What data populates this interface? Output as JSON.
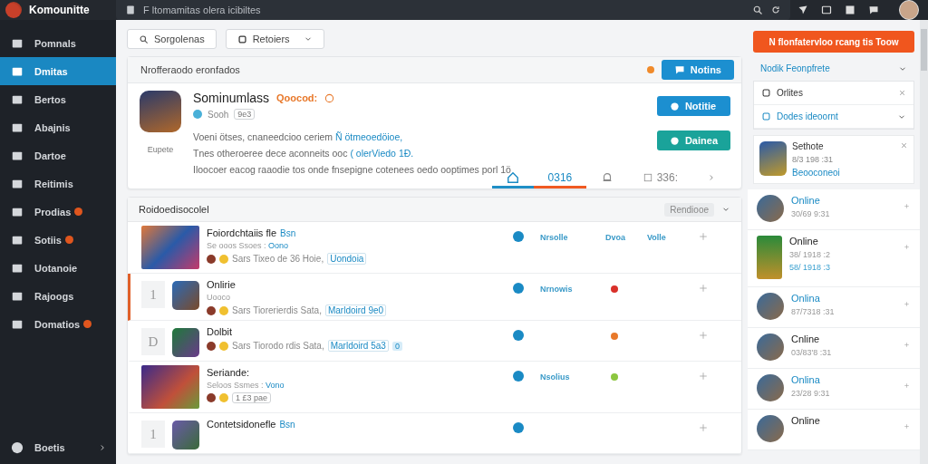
{
  "topbar": {
    "app_name": "Komounitte",
    "address": "F ltomamitas olera icibiltes"
  },
  "sidebar": {
    "items": [
      {
        "label": "Pomnals",
        "selected": false,
        "badge": false
      },
      {
        "label": "Dmitas",
        "selected": true,
        "badge": false
      },
      {
        "label": "Bertos",
        "selected": false,
        "badge": false
      },
      {
        "label": "Abajnis",
        "selected": false,
        "badge": false
      },
      {
        "label": "Dartoe",
        "selected": false,
        "badge": false
      },
      {
        "label": "Reitimis",
        "selected": false,
        "badge": false
      },
      {
        "label": "Prodias",
        "selected": false,
        "badge": true
      },
      {
        "label": "Sotiis",
        "selected": false,
        "badge": true
      },
      {
        "label": "Uotanoie",
        "selected": false,
        "badge": false
      },
      {
        "label": "Rajoogs",
        "selected": false,
        "badge": false
      },
      {
        "label": "Domatios",
        "selected": false,
        "badge": true
      }
    ],
    "footer": "Boetis"
  },
  "filters": [
    {
      "label": "Sorgolenas",
      "kind": "search"
    },
    {
      "label": "Retoiers",
      "kind": "dropdown"
    }
  ],
  "featured": {
    "header": "Nrofferaodo eronfados",
    "header_button": "Notins",
    "name": "Sominumlass",
    "tag": "Qoocod:",
    "caption": "Eupete",
    "sub": "Sooh",
    "sub_badge": "9e3",
    "lines": [
      {
        "text": "Voeni ötses, cnaneedcioo ceriem",
        "link": "Ñ ötmeoedöioe,"
      },
      {
        "text": "Tnes otheroeree dece aconneits ooc",
        "link": "( olerViedo 1Ð."
      },
      {
        "text": "Iloocoer eacog raaodie tos onde fnsepigne cotenees oedo ooptimes porl 1ö"
      }
    ],
    "buttons": [
      {
        "label": "Notitie",
        "kind": "primary"
      },
      {
        "label": "Dainea",
        "kind": "secondary"
      }
    ],
    "tabs": [
      {
        "kind": "home",
        "selected": true,
        "color": "#1f8fc6"
      },
      {
        "kind": "text",
        "label": "0316",
        "selected": true,
        "color": "#f05a22"
      },
      {
        "kind": "bell",
        "selected": false
      },
      {
        "kind": "count",
        "label": "336:",
        "selected": false
      },
      {
        "kind": "next",
        "selected": false
      }
    ]
  },
  "list": {
    "title": "Roidoedisocolel",
    "sort": "Rendiooe",
    "rows": [
      {
        "kind": "thumb",
        "selected": false,
        "title": "Foiordchtaiis fle",
        "tag": "Bsn",
        "sub": "Se ooos Ssoes :",
        "sub_link": "Oono",
        "meta": "Sars Tixeo de 36 Hoie,",
        "meta_link": "Uondoia",
        "status_label": "Nrsolle",
        "col2": "Dvoa",
        "col3": "Volle"
      },
      {
        "kind": "numbered",
        "number": "1",
        "selected": true,
        "title": "Onlirie",
        "sub": "Uooco",
        "meta": "Sars Tiorerierdis Sata,",
        "meta_link": "Marldoird 9e0",
        "status_label": "Nrnowis",
        "color": "#d9302a"
      },
      {
        "kind": "numbered",
        "number": "D",
        "selected": false,
        "title": "Dolbit",
        "meta": "Sars Tiorodo rdis Sata,",
        "meta_link": "Marldoird 5a3",
        "extra_badge": "0",
        "color": "#e8792a"
      },
      {
        "kind": "thumb",
        "selected": false,
        "title": "Seriande:",
        "sub": "Seloos Ssmes :",
        "sub_link": "Vono",
        "meta_chip": "1 £3 pae",
        "status_label": "Nsolius",
        "color": "#8cc63f"
      },
      {
        "kind": "numbered",
        "number": "1",
        "selected": false,
        "title": "Contetsidonefle",
        "tag": "Bsn"
      }
    ]
  },
  "side_panel": {
    "cta": "N flonfatervloo rcang tis Toow",
    "section": "Nodik Feonpfrete",
    "filters": [
      {
        "label": "Orlites",
        "kind": "close"
      },
      {
        "label": "Dodes ideoornt",
        "kind": "expand"
      }
    ],
    "profile": {
      "name": "Sethote",
      "time": "8/3 198 :31",
      "link": "Beooconeoi"
    },
    "online": [
      {
        "name": "Online",
        "highlighted": true,
        "time": "30/69 9:31"
      },
      {
        "name": "Online",
        "highlighted": false,
        "time": "38/ 1918 :2",
        "time2": "58/ 1918 :3"
      },
      {
        "name": "Onlina",
        "highlighted": true,
        "time": "87/7318 :31"
      },
      {
        "name": "Cnline",
        "highlighted": false,
        "time": "03/83'8 :31"
      },
      {
        "name": "Onlina",
        "highlighted": true,
        "time": "23/28 9:31"
      },
      {
        "name": "Online",
        "highlighted": false
      }
    ]
  }
}
